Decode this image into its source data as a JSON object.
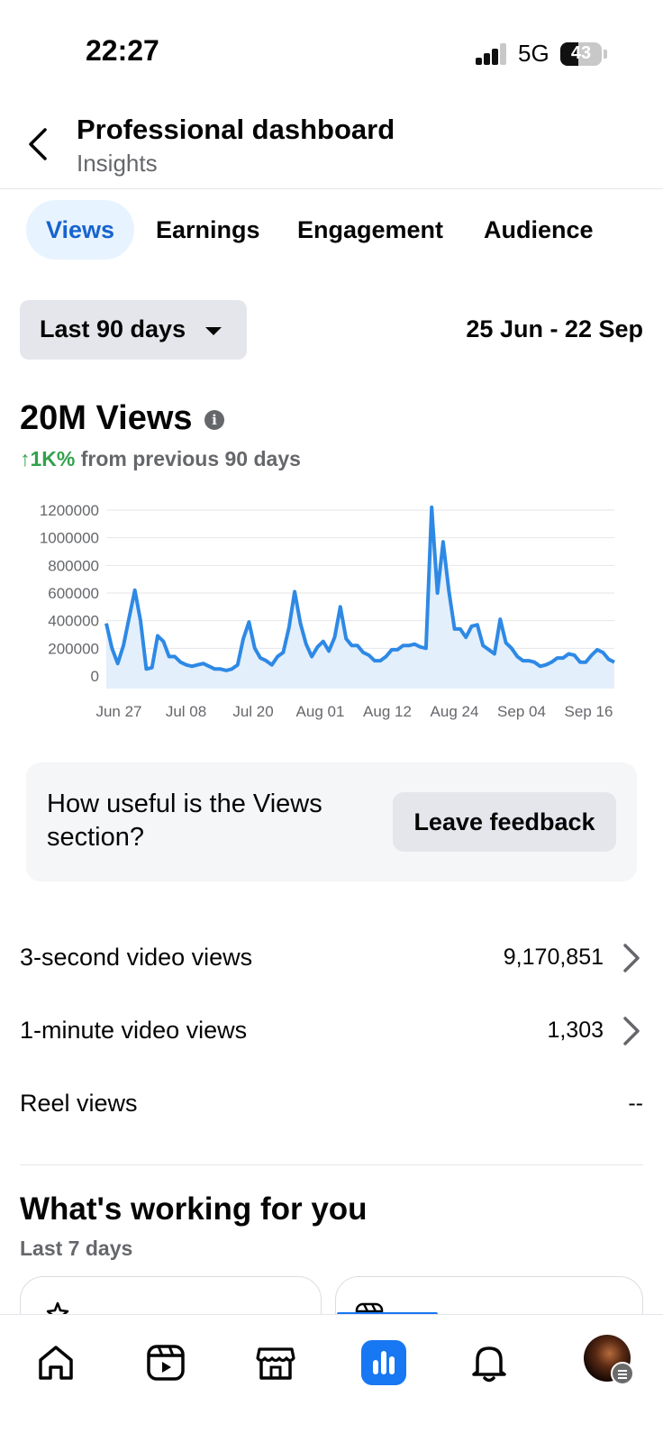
{
  "status_bar": {
    "time": "22:27",
    "network": "5G",
    "battery": "43",
    "battery_level": 0.43
  },
  "header": {
    "title": "Professional dashboard",
    "subtitle": "Insights"
  },
  "tabs": [
    {
      "label": "Views",
      "active": true
    },
    {
      "label": "Earnings",
      "active": false
    },
    {
      "label": "Engagement",
      "active": false
    },
    {
      "label": "Audience",
      "active": false
    }
  ],
  "range": {
    "selected": "Last 90 days",
    "dates": "25 Jun - 22 Sep"
  },
  "metric": {
    "value": "20M Views",
    "change_pct": "1K%",
    "change_text": "from previous 90 days"
  },
  "chart_data": {
    "type": "area",
    "x_start": "Jun 25",
    "x_end": "Sep 22",
    "x_tick_labels": [
      "Jun 27",
      "Jul 08",
      "Jul 20",
      "Aug 01",
      "Aug 12",
      "Aug 24",
      "Sep 04",
      "Sep 16"
    ],
    "y_tick_labels": [
      "1200000",
      "1000000",
      "800000",
      "600000",
      "400000",
      "200000",
      "0"
    ],
    "ylim": [
      0,
      1200000
    ],
    "grid": true,
    "color": "#2e89e5",
    "fill": "#e3effb",
    "values": [
      380000,
      200000,
      90000,
      220000,
      420000,
      620000,
      400000,
      50000,
      60000,
      290000,
      250000,
      140000,
      140000,
      100000,
      80000,
      70000,
      80000,
      90000,
      70000,
      50000,
      50000,
      40000,
      50000,
      80000,
      270000,
      390000,
      200000,
      130000,
      110000,
      80000,
      140000,
      170000,
      350000,
      610000,
      380000,
      230000,
      140000,
      210000,
      250000,
      180000,
      280000,
      500000,
      270000,
      220000,
      220000,
      170000,
      150000,
      110000,
      110000,
      140000,
      190000,
      190000,
      220000,
      220000,
      230000,
      210000,
      200000,
      1220000,
      600000,
      970000,
      620000,
      340000,
      340000,
      280000,
      360000,
      370000,
      220000,
      190000,
      160000,
      410000,
      240000,
      200000,
      140000,
      110000,
      110000,
      100000,
      70000,
      80000,
      100000,
      130000,
      130000,
      160000,
      150000,
      100000,
      100000,
      150000,
      190000,
      170000,
      120000,
      100000
    ]
  },
  "feedback": {
    "question": "How useful is the Views section?",
    "button": "Leave feedback"
  },
  "stats": [
    {
      "label": "3-second video views",
      "value": "9,170,851",
      "has_chevron": true
    },
    {
      "label": "1-minute video views",
      "value": "1,303",
      "has_chevron": true
    },
    {
      "label": "Reel views",
      "value": "--",
      "has_chevron": false
    }
  ],
  "section": {
    "title": "What's working for you",
    "subtitle": "Last 7 days"
  },
  "nav": {
    "items": [
      "home-icon",
      "reels-icon",
      "marketplace-icon",
      "dashboard-icon",
      "notifications-icon",
      "profile-avatar"
    ],
    "active": "dashboard-icon",
    "accent": "#1877f2"
  }
}
